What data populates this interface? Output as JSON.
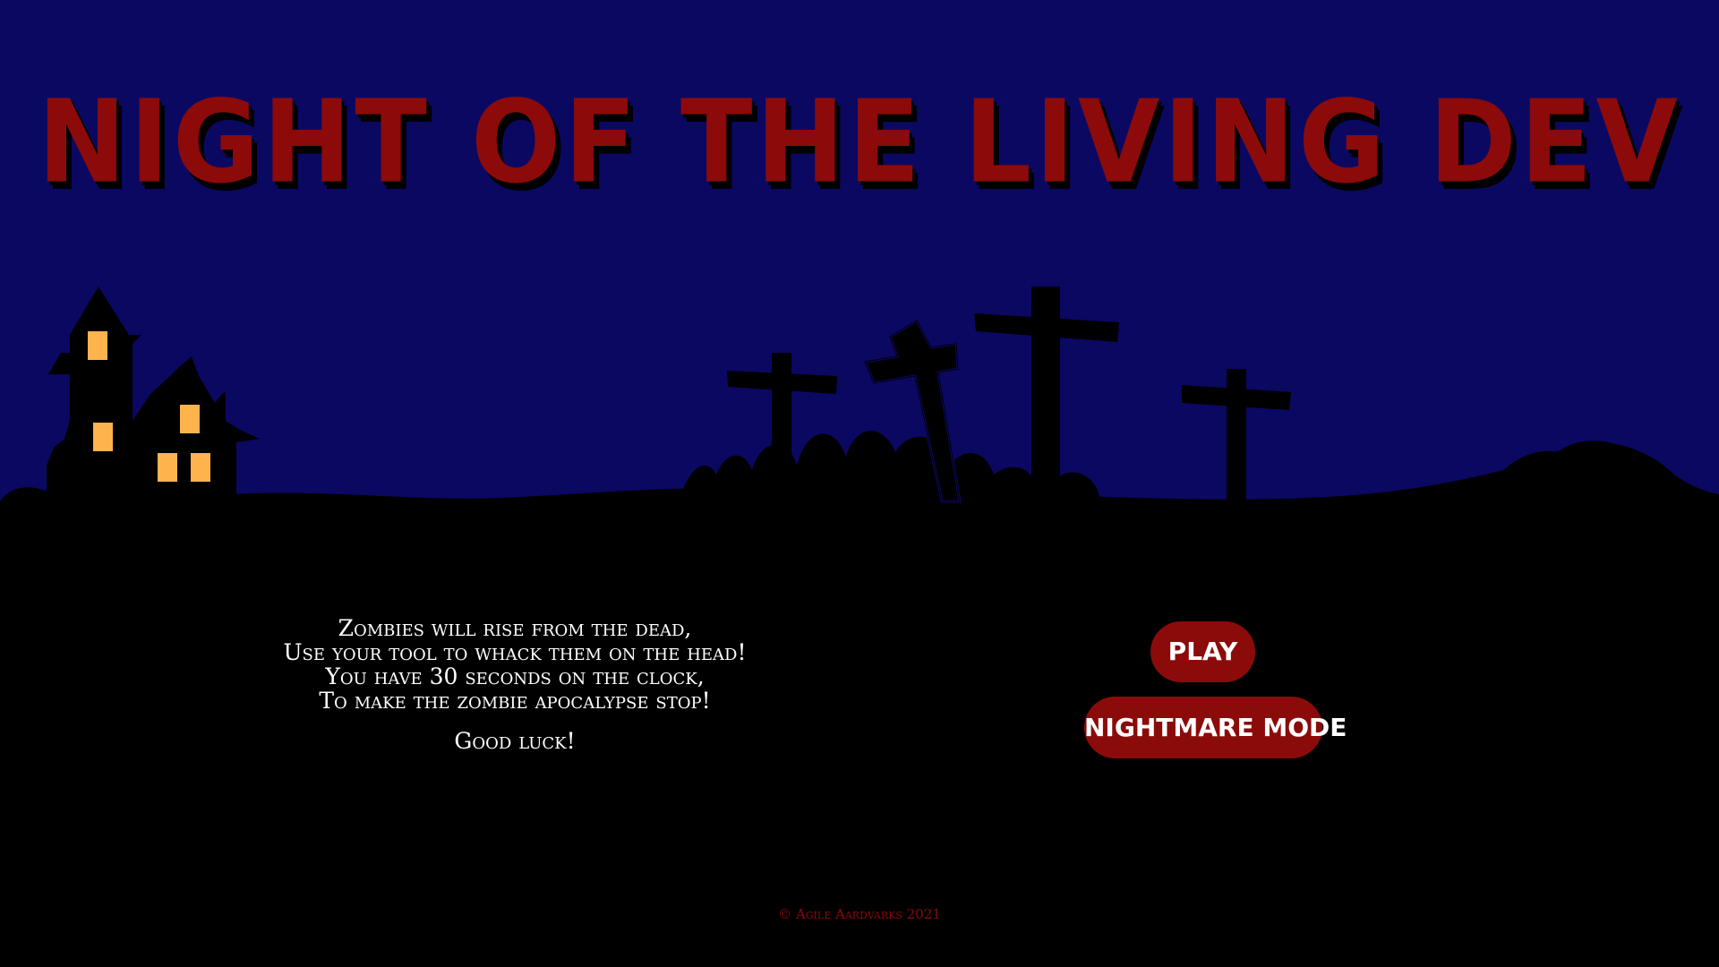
{
  "game": {
    "title": "Night of the Living Dev"
  },
  "instructions": {
    "lines": [
      "Zombies will rise from the dead,",
      "Use your tool to whack them on the head!",
      "You have 30 seconds on the clock,",
      "To make the zombie apocalypse stop!"
    ],
    "closing": "Good luck!"
  },
  "buttons": {
    "play_label": "Play",
    "nightmare_label": "Nightmare Mode"
  },
  "footer": {
    "copyright": "© Agile Aardvarks 2021"
  },
  "colors": {
    "sky": "#0b0862",
    "ground": "#000000",
    "blood_red": "#8c0a0a",
    "window_light": "#ffb34d"
  },
  "icons": [
    "haunted-house-icon",
    "grave-cross-icon",
    "tombstone-cross-icon",
    "grass-icon"
  ]
}
